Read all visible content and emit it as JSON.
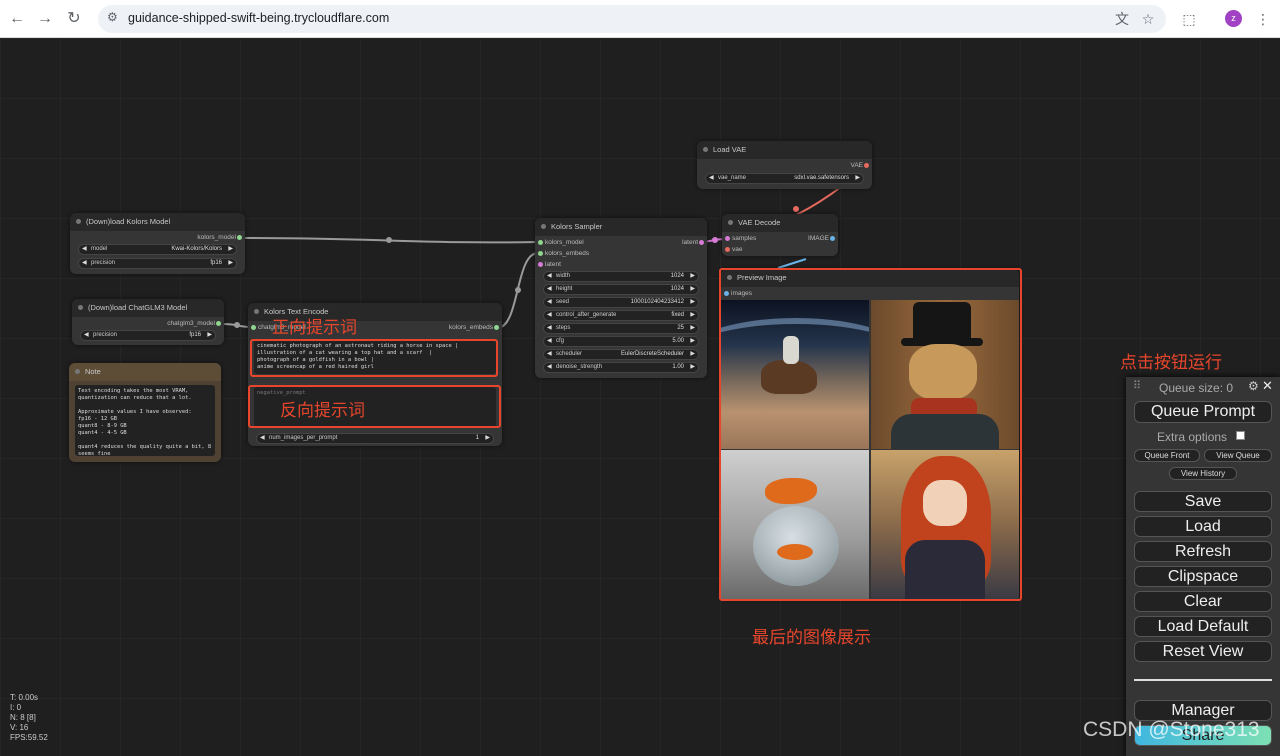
{
  "browser": {
    "url": "guidance-shipped-swift-being.trycloudflare.com",
    "avatar_letter": "z"
  },
  "nodes": {
    "load_kolors": {
      "title": "(Down)load Kolors Model",
      "output": "kolors_model",
      "model_label": "model",
      "model_value": "Kwai-Kolors/Kolors",
      "precision_label": "precision",
      "precision_value": "fp16"
    },
    "load_chatglm": {
      "title": "(Down)load ChatGLM3 Model",
      "output": "chatglm3_model",
      "precision_label": "precision",
      "precision_value": "fp16"
    },
    "note": {
      "title": "Note",
      "text": "Text encoding takes the most VRAM,\nquantization can reduce that a lot.\n\nApproximate values I have observed:\nfp16 - 12 GB\nquant8 - 8-9 GB\nquant4 - 4-5 GB\n\nquant4 reduces the quality quite a bit, 8\nseems fine"
    },
    "text_encode": {
      "title": "Kolors Text Encode",
      "input": "chatglm3_model",
      "output": "kolors_embeds",
      "prompt": "cinematic photograph of an astronaut riding a horse in space |\nillustration of a cat wearing a top hat and a scarf  |\nphotograph of a goldfish in a bowl |\nanime screencap of a red haired girl",
      "negative_placeholder": "negative_prompt",
      "num_images_label": "num_images_per_prompt",
      "num_images_value": "1"
    },
    "sampler": {
      "title": "Kolors Sampler",
      "inputs": [
        "kolors_model",
        "kolors_embeds",
        "latent"
      ],
      "output": "latent",
      "widgets": [
        {
          "label": "width",
          "value": "1024"
        },
        {
          "label": "height",
          "value": "1024"
        },
        {
          "label": "seed",
          "value": "1000102404233412"
        },
        {
          "label": "control_after_generate",
          "value": "fixed"
        },
        {
          "label": "steps",
          "value": "25"
        },
        {
          "label": "cfg",
          "value": "5.00"
        },
        {
          "label": "scheduler",
          "value": "EulerDiscreteScheduler"
        },
        {
          "label": "denoise_strength",
          "value": "1.00"
        }
      ]
    },
    "load_vae": {
      "title": "Load VAE",
      "output": "VAE",
      "vae_label": "vae_name",
      "vae_value": "sdxl.vae.safetensors"
    },
    "vae_decode": {
      "title": "VAE Decode",
      "input_samples": "samples",
      "input_vae": "vae",
      "output": "IMAGE"
    },
    "preview": {
      "title": "Preview Image",
      "input": "images"
    }
  },
  "annotations": {
    "positive": "正向提示词",
    "negative": "反向提示词",
    "click_run": "点击按钮运行",
    "final_image": "最后的图像展示"
  },
  "menu": {
    "queue_size": "Queue size: 0",
    "queue_prompt": "Queue Prompt",
    "extra_options": "Extra options",
    "queue_front": "Queue Front",
    "view_queue": "View Queue",
    "view_history": "View History",
    "save": "Save",
    "load": "Load",
    "refresh": "Refresh",
    "clipspace": "Clipspace",
    "clear": "Clear",
    "load_default": "Load Default",
    "reset_view": "Reset View",
    "manager": "Manager",
    "share": "Share"
  },
  "stats": [
    "T: 0.00s",
    "I: 0",
    "N: 8 [8]",
    "V: 16",
    "FPS:59.52"
  ],
  "watermark": "CSDN @Stone313",
  "colors": {
    "accent_red": "#e8462c",
    "canvas": "#1f1f1f",
    "node": "#353535"
  }
}
